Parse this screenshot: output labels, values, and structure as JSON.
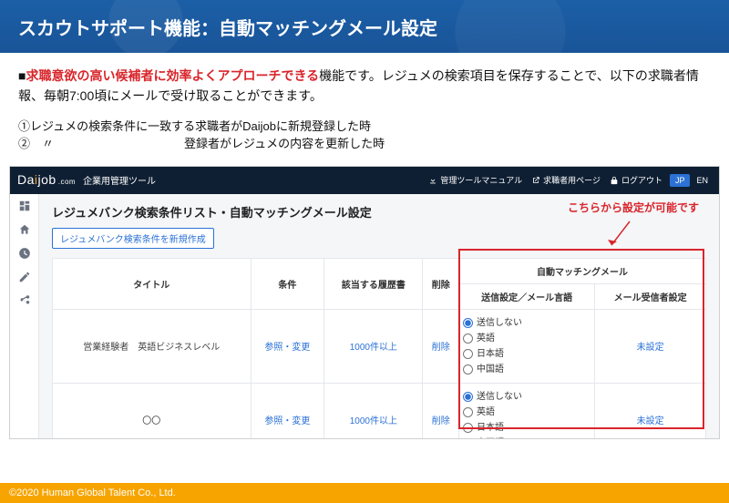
{
  "hero": {
    "title": "スカウトサポート機能：自動マッチングメール設定"
  },
  "desc": {
    "prefix": "■",
    "highlight": "求職意欲の高い候補者に効率よくアプローチできる",
    "rest": "機能です。レジュメの検索項目を保存することで、以下の求職者情報、毎朝7:00頃にメールで受け取ることができます。"
  },
  "bullets": {
    "b1": "①レジュメの検索条件に一致する求職者がDaijobに新規登録した時",
    "b2": "②　〃　　　　　　　　　　　登録者がレジュメの内容を更新した時"
  },
  "hint": "こちらから設定が可能です",
  "topbar": {
    "logo_prefix": "Da",
    "logo_i": "i",
    "logo_suffix": "job",
    "logo_small": ".com",
    "tool": "企業用管理ツール",
    "manual": "管理ツールマニュアル",
    "seeker": "求職者用ページ",
    "logout": "ログアウト",
    "jp": "JP",
    "en": "EN"
  },
  "page": {
    "title": "レジュメバンク検索条件リスト・自動マッチングメール設定",
    "new_button": "レジュメバンク検索条件を新規作成"
  },
  "table": {
    "headers": {
      "title": "タイトル",
      "cond": "条件",
      "resumes": "該当する履歴書",
      "delete": "削除",
      "auto_group": "自動マッチングメール",
      "send_lang": "送信設定／メール言語",
      "recipient": "メール受信者設定"
    },
    "options": {
      "none": "送信しない",
      "en": "英語",
      "ja": "日本語",
      "zh": "中国語"
    },
    "rows": [
      {
        "title": "営業経験者　英語ビジネスレベル",
        "cond": "参照・変更",
        "resumes": "1000件以上",
        "delete": "削除",
        "recipient": "未設定"
      },
      {
        "title": "〇〇",
        "cond": "参照・変更",
        "resumes": "1000件以上",
        "delete": "削除",
        "recipient": "未設定"
      }
    ]
  },
  "footer": {
    "copyright": "©2020 Human Global Talent Co., Ltd."
  }
}
